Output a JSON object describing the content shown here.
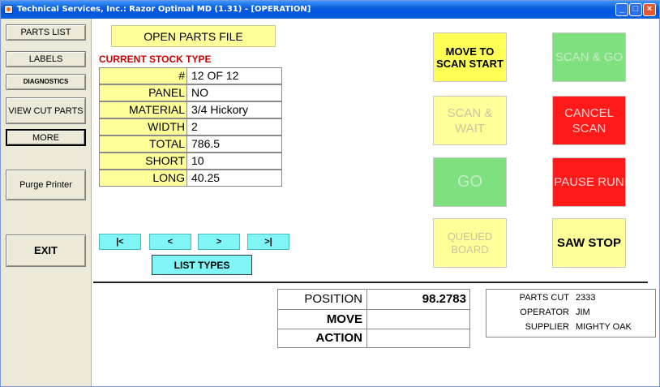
{
  "window": {
    "title": "Technical Services, Inc.: Razor Optimal MD (1.31) - [OPERATION]"
  },
  "sidebar": {
    "parts_list": "PARTS LIST",
    "labels": "LABELS",
    "diagnostics": "DIAGNOSTICS",
    "view_cut_parts": "VIEW CUT PARTS",
    "more": "MORE",
    "purge_printer": "Purge Printer",
    "exit": "EXIT"
  },
  "main": {
    "open_parts_file": "OPEN PARTS FILE",
    "current_stock_title": "CURRENT STOCK TYPE",
    "stock": [
      {
        "label": "#",
        "value": "12 OF 12"
      },
      {
        "label": "PANEL",
        "value": "NO"
      },
      {
        "label": "MATERIAL",
        "value": "3/4 Hickory"
      },
      {
        "label": "WIDTH",
        "value": "2"
      },
      {
        "label": "TOTAL",
        "value": "786.5"
      },
      {
        "label": "SHORT",
        "value": "10"
      },
      {
        "label": "LONG",
        "value": "40.25"
      }
    ],
    "nav": {
      "first": "|<",
      "prev": "<",
      "next": ">",
      "last": ">|"
    },
    "list_types": "LIST TYPES"
  },
  "controls": {
    "move_to_scan_start": "MOVE TO SCAN START",
    "scan_and_go": "SCAN & GO",
    "scan_and_wait": "SCAN & WAIT",
    "cancel_scan": "CANCEL SCAN",
    "go": "GO",
    "pause_run": "PAUSE RUN",
    "queued_board": "QUEUED BOARD",
    "saw_stop": "SAW STOP"
  },
  "position_panel": {
    "position_label": "POSITION",
    "position_value": "98.2783",
    "move_label": "MOVE",
    "move_value": "",
    "action_label": "ACTION",
    "action_value": ""
  },
  "info_panel": {
    "parts_cut_label": "PARTS CUT",
    "parts_cut_value": "2333",
    "operator_label": "OPERATOR",
    "operator_value": "JIM",
    "supplier_label": "SUPPLIER",
    "supplier_value": "MIGHTY OAK"
  },
  "colors": {
    "title_bar": "#0055e5",
    "label_yellow": "#ffff99",
    "active_yellow": "#ffff55",
    "nav_cyan": "#7ff5f5",
    "go_green": "#7fe07f",
    "stop_red": "#ff1a1a",
    "stock_title_red": "#d00000"
  }
}
